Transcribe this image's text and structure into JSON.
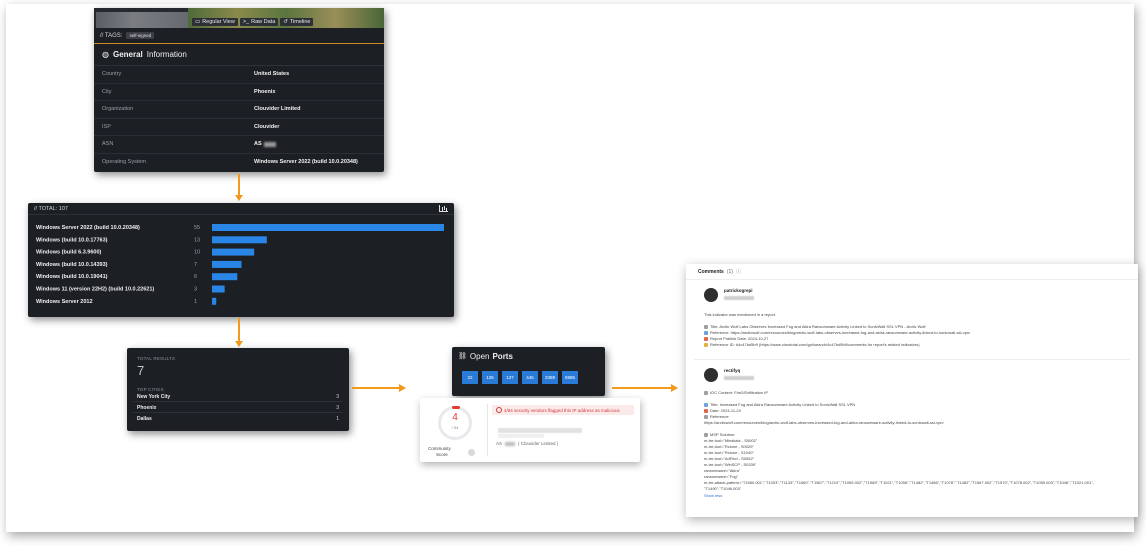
{
  "general_panel": {
    "view_buttons": [
      "Regular View",
      "Raw Data",
      "Timeline"
    ],
    "tags_label": "// TAGS:",
    "tag": "self-signed",
    "title_bold": "General",
    "title_rest": "Information",
    "rows": [
      {
        "key": "Country",
        "value": "United States"
      },
      {
        "key": "City",
        "value": "Phoenix"
      },
      {
        "key": "Organization",
        "value": "Clouvider Limited"
      },
      {
        "key": "ISP",
        "value": "Clouvider"
      },
      {
        "key": "ASN",
        "value": "AS"
      },
      {
        "key": "Operating System",
        "value": "Windows Server 2022 (build 10.0.20348)"
      }
    ]
  },
  "os_panel": {
    "total_label": "// TOTAL: 107",
    "chart_data": {
      "type": "bar",
      "orientation": "horizontal",
      "categories": [
        "Windows Server 2022 (build 10.0.20348)",
        "Windows (build 10.0.17763)",
        "Windows (build 6.3.9600)",
        "Windows (build 10.0.14393)",
        "Windows (build 10.0.19041)",
        "Windows 11 (version 22H2) (build 10.0.22621)",
        "Windows Server 2012"
      ],
      "values": [
        55,
        13,
        10,
        7,
        6,
        3,
        1
      ],
      "bar_color": "#2a86e6"
    }
  },
  "results_panel": {
    "total_label": "TOTAL RESULTS",
    "total_value": "7",
    "top_cities_label": "TOP CITIES",
    "cities": [
      {
        "name": "New York City",
        "count": "3"
      },
      {
        "name": "Phoenix",
        "count": "3"
      },
      {
        "name": "Dallas",
        "count": "1"
      }
    ]
  },
  "ports_panel": {
    "title_rest": "Open",
    "title_bold": "Ports",
    "ports": [
      "22",
      "135",
      "137",
      "445",
      "3389",
      "5985"
    ],
    "port_color": "#2a7bd8"
  },
  "score_panel": {
    "score": "4",
    "denominator": "/ 94",
    "label_line1": "Community",
    "label_line2": "Score",
    "alert_text": "4/94 security vendors flagged this IP address as malicious",
    "asn_prefix": "AS",
    "asn_org": "( Clouvider Limited )"
  },
  "comments_panel": {
    "title": "Comments",
    "count": "(1)",
    "comments": [
      {
        "user": "patrickogrepi",
        "lines": [
          "This indicator was mentioned in a report.",
          "Title: Arctic Wolf Labs Observes Increased Fog and Akira Ransomware Activity Linked to SonicWall SSL VPN - Arctic Wolf",
          "Reference: https://arcticwolf.com/resources/blog/arctic-wolf-labs-observes-increased-fog-and-akira-ransomware-activity-linked-to-sonicwall-ssl-vpn/",
          "Report Publish Date: 2024-10-27",
          "Reference ID: #4c47bd5b9 (https://www.virustotal.com/gui/search/4c47bd5b9/comments for report's related indicators)"
        ]
      },
      {
        "user": "rectifyq",
        "lines": [
          "IOC Context: Fire2/Exfiltration IP",
          "Title: Increased Fog and Akira Ransomware Activity Linked to SonicWall SSL VPN",
          "Date: 2024-11-24",
          "Reference:",
          "https://arcticwolf.com/resources/blog/arctic-wolf-labs-observes-increased-fog-and-akira-ransomware-activity-linked-to-sonicwall-ssl-vpn/",
          "MSP Solution:",
          "m-tre-tool=\"Mimikatz - S0002\"",
          "m-tre-tool=\"Rclone - S0029\"",
          "m-tre-tool=\"Rclone - S1040\"",
          "m-tre-tool=\"AdFind - S0552\"",
          "m-tre-tool=\"WinSCP - S0339\"",
          "ransomware=\"Akira\"",
          "ransomware=\"Fog\"",
          "m-tre-attack-pattern=\"T1560.001\",\"T1003\",\"T1133\",\"T1560\",\"T1567\",\"T1210\",\"T1059.002\",\"T1569\",\"T1021\",\"T1098\",\"T1482\",\"T1486\",\"T1078\",\"T1482\",\"T1567.002\",\"T1570\",\"T1078.002\",\"T1059.003\",\"T1046\",\"T1021.001\",",
          "\"T1490\",\"T1046.003\""
        ],
        "show_less": "Show less"
      }
    ]
  },
  "colors": {
    "accent_orange": "#f29a1c",
    "panel_dark": "#1c1f24",
    "alert_red": "#d23b3b"
  }
}
